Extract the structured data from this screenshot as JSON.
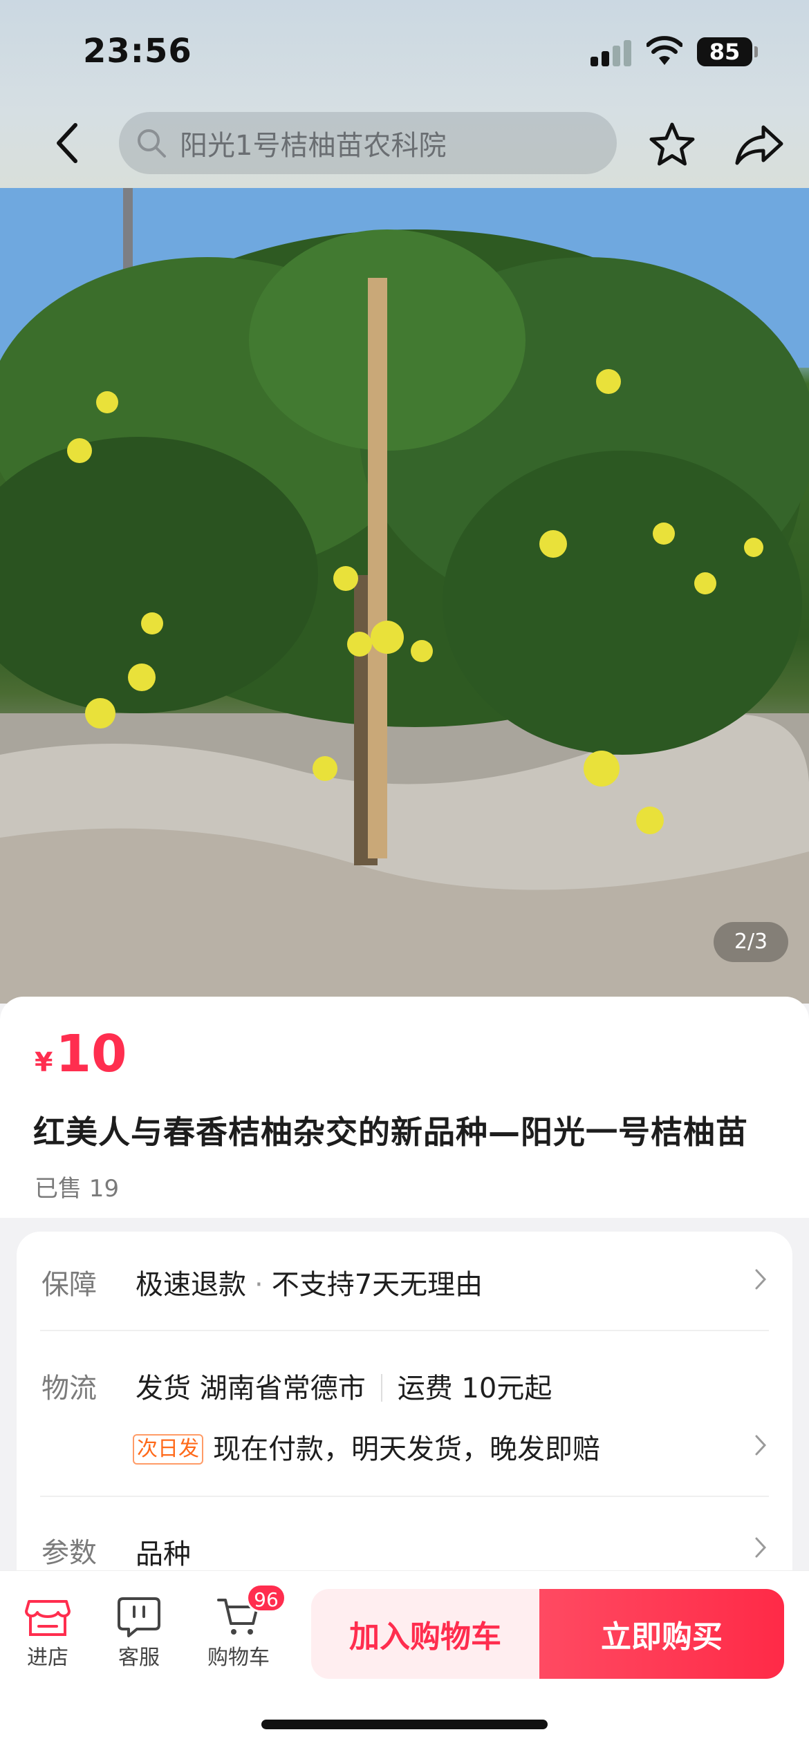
{
  "status_bar": {
    "time": "23:56",
    "battery": "85"
  },
  "nav": {
    "search_text": "阳光1号桔柚苗农科院"
  },
  "gallery": {
    "pager": "2/3"
  },
  "product": {
    "currency": "¥",
    "price": "10",
    "title": "红美人与春香桔柚杂交的新品种—阳光一号桔柚苗",
    "sold": "已售 19"
  },
  "services": {
    "guarantee": {
      "label": "保障",
      "text_a": "极速退款",
      "sep": "·",
      "text_b": "不支持7天无理由"
    },
    "logistics": {
      "label": "物流",
      "ship": "发货 湖南省常德市",
      "fee": "运费 10元起",
      "tag": "次日发",
      "promise": "现在付款，明天发货，晚发即赔"
    },
    "params": {
      "label": "参数",
      "text": "品种"
    }
  },
  "bottom_bar": {
    "store": "进店",
    "service": "客服",
    "cart": "购物车",
    "cart_count": "96",
    "add_to_cart": "加入购物车",
    "buy_now": "立即购买"
  },
  "colors": {
    "accent": "#ff2d4e",
    "tag": "#ff6a1a"
  }
}
